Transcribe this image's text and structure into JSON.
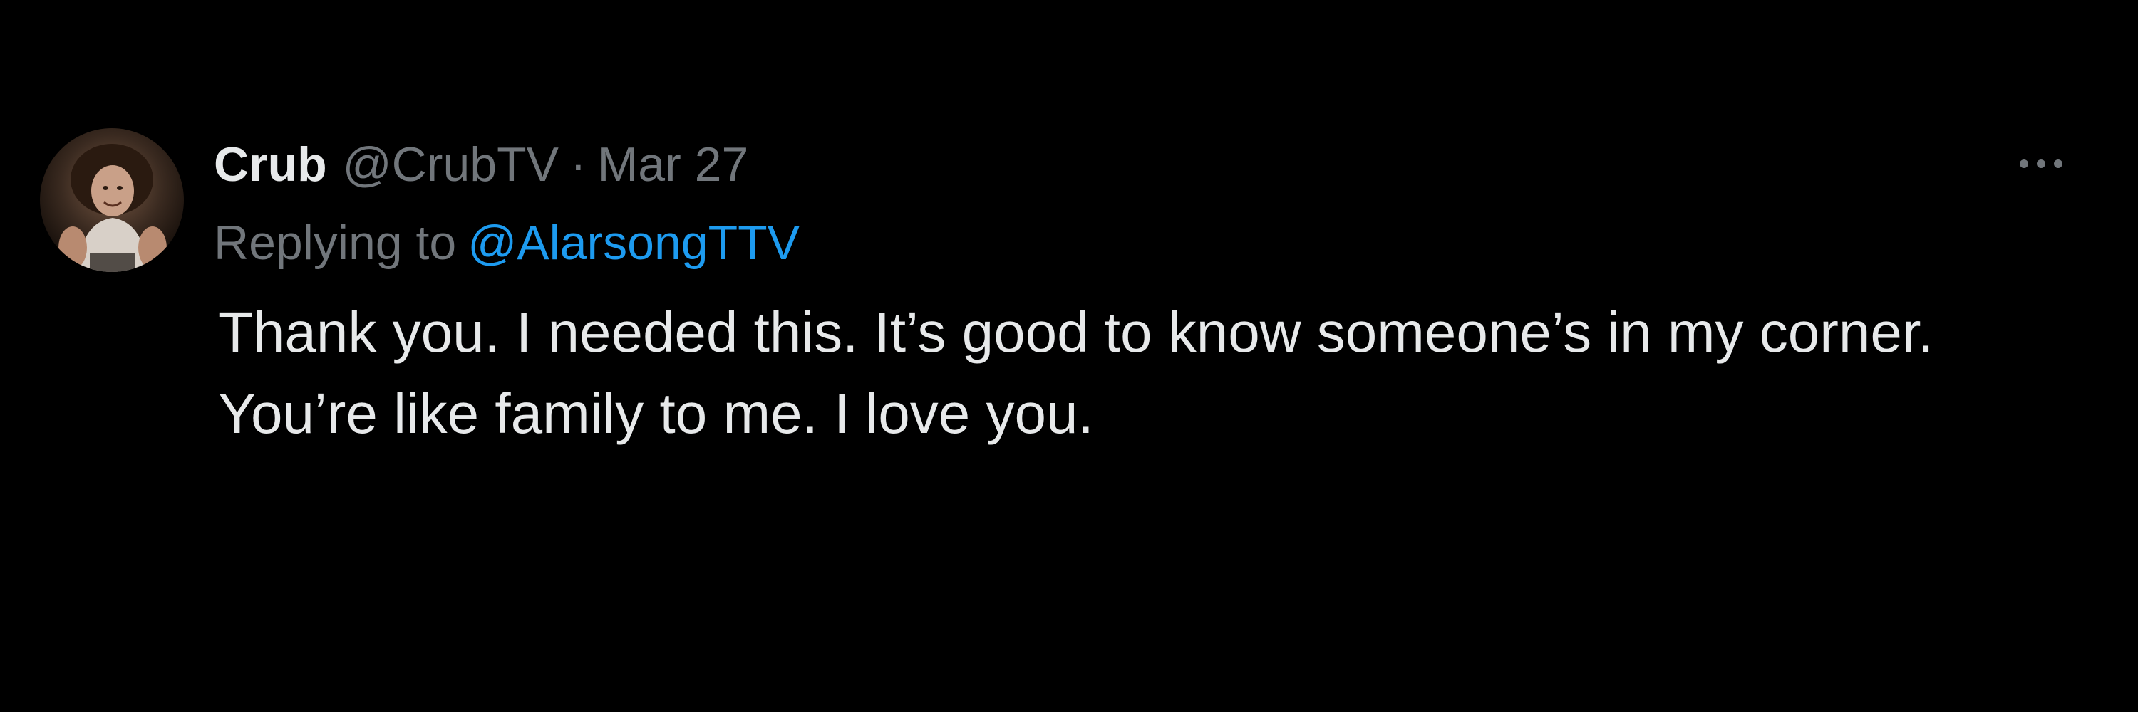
{
  "tweet": {
    "author": {
      "display_name": "Crub",
      "handle": "@CrubTV"
    },
    "separator": "·",
    "date": "Mar 27",
    "replying_to": {
      "prefix": "Replying to",
      "handle": "@AlarsongTTV"
    },
    "text_lines": [
      "Thank you. I needed this. It’s good to know someone’s in my corner.",
      "You’re like family to me. I love you."
    ],
    "more_icon": "more-horizontal-icon"
  },
  "colors": {
    "background": "#000000",
    "primary_text": "#e7e9ea",
    "secondary_text": "#71767b",
    "link": "#1d9bf0"
  }
}
